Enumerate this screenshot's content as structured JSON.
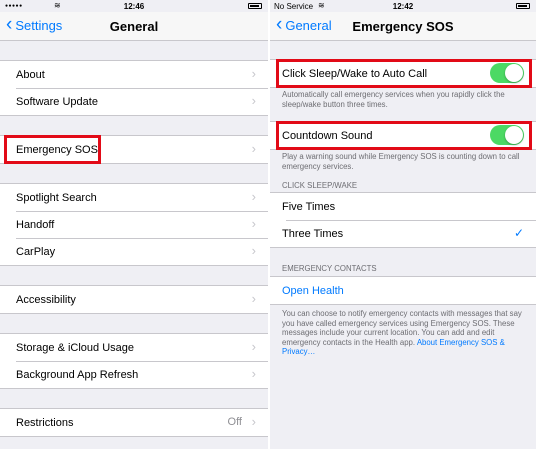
{
  "left": {
    "status": {
      "time": "12:46"
    },
    "nav": {
      "back_label": "Settings",
      "title": "General"
    },
    "groups": [
      [
        {
          "label": "About"
        },
        {
          "label": "Software Update"
        }
      ],
      [
        {
          "label": "Emergency SOS"
        }
      ],
      [
        {
          "label": "Spotlight Search"
        },
        {
          "label": "Handoff"
        },
        {
          "label": "CarPlay"
        }
      ],
      [
        {
          "label": "Accessibility"
        }
      ],
      [
        {
          "label": "Storage & iCloud Usage"
        },
        {
          "label": "Background App Refresh"
        }
      ],
      [
        {
          "label": "Restrictions",
          "detail": "Off"
        }
      ]
    ]
  },
  "right": {
    "status": {
      "carrier": "No Service",
      "time": "12:42"
    },
    "nav": {
      "back_label": "General",
      "title": "Emergency SOS"
    },
    "auto_call": {
      "label": "Click Sleep/Wake to Auto Call",
      "on": true,
      "footer": "Automatically call emergency services when you rapidly click the sleep/wake button three times."
    },
    "countdown": {
      "label": "Countdown Sound",
      "on": true,
      "footer": "Play a warning sound while Emergency SOS is counting down to call emergency services."
    },
    "click_section": {
      "header": "CLICK SLEEP/WAKE",
      "options": [
        {
          "label": "Five Times",
          "selected": false
        },
        {
          "label": "Three Times",
          "selected": true
        }
      ]
    },
    "contacts_section": {
      "header": "EMERGENCY CONTACTS",
      "open_health": "Open Health",
      "footer": "You can choose to notify emergency contacts with messages that say you have called emergency services using Emergency SOS. These messages include your current location. You can add and edit emergency contacts in the Health app.",
      "footer_link": "About Emergency SOS & Privacy…"
    }
  },
  "colors": {
    "accent": "#007aff",
    "toggle_on": "#4cd964",
    "highlight": "#e20a17",
    "background": "#efeff4"
  }
}
